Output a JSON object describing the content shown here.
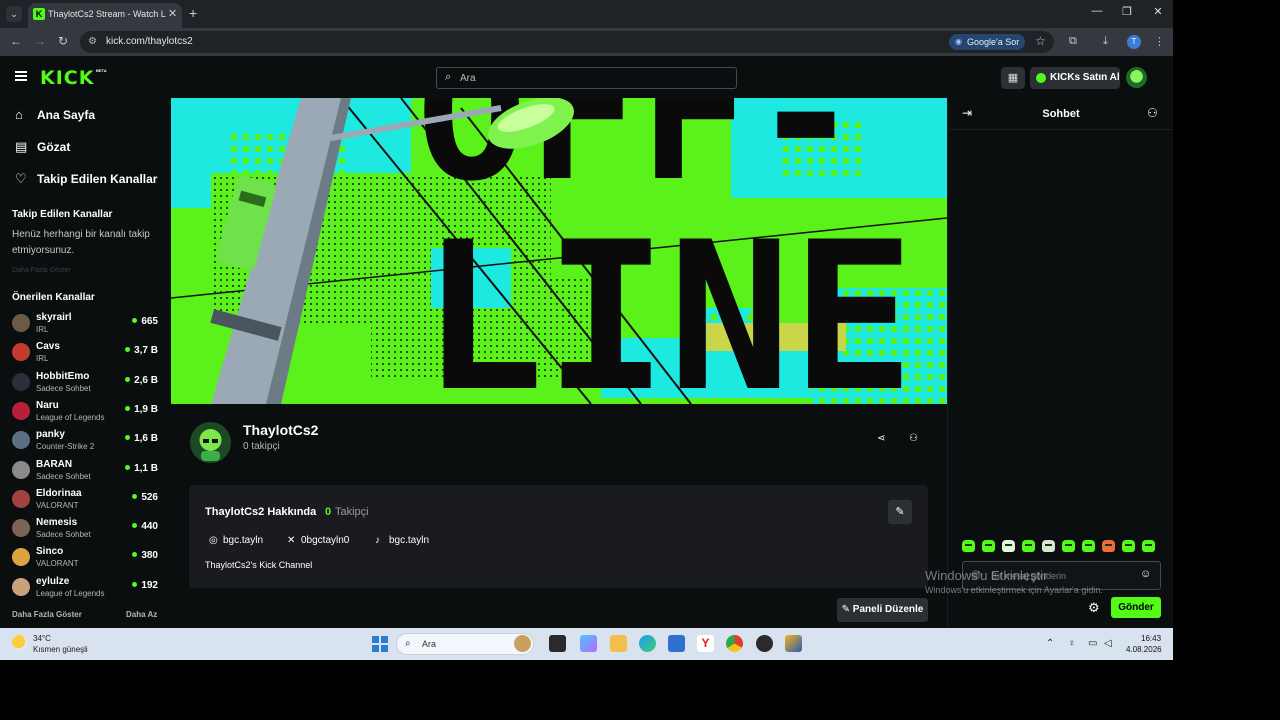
{
  "browser": {
    "tab_title": "ThaylotCs2 Stream - Watch Live",
    "tab_close": "✕",
    "new_tab": "+",
    "url": "kick.com/thaylotcs2",
    "google_button": "Google'a Sor",
    "window_minimize": "—",
    "window_restore": "❐",
    "window_close": "✕",
    "profile_initial": "T"
  },
  "header": {
    "logo": "KICK",
    "logo_badge": "BETA",
    "search_placeholder": "Ara",
    "kicks_button": "KICKs Satın Al"
  },
  "sidebar": {
    "nav": [
      {
        "label": "Ana Sayfa",
        "icon": "home-icon"
      },
      {
        "label": "Gözat",
        "icon": "browse-icon"
      },
      {
        "label": "Takip Edilen Kanallar",
        "icon": "heart-icon"
      }
    ],
    "followed_title": "Takip Edilen Kanallar",
    "followed_empty": "Henüz herhangi bir kanalı takip etmiyorsunuz.",
    "followed_more": "Daha Fazla Göster",
    "recommended_title": "Önerilen Kanallar",
    "channels": [
      {
        "name": "skyrairl",
        "category": "IRL",
        "viewers": "665",
        "color": "#6b5a4a"
      },
      {
        "name": "Cavs",
        "category": "IRL",
        "viewers": "3,7 B",
        "color": "#c43b2e"
      },
      {
        "name": "HobbitEmo",
        "category": "Sadece Sohbet",
        "viewers": "2,6 B",
        "color": "#2b2f3a"
      },
      {
        "name": "Naru",
        "category": "League of Legends",
        "viewers": "1,9 B",
        "color": "#b8203a"
      },
      {
        "name": "panky",
        "category": "Counter-Strike 2",
        "viewers": "1,6 B",
        "color": "#5b6f85"
      },
      {
        "name": "BARAN",
        "category": "Sadece Sohbet",
        "viewers": "1,1 B",
        "color": "#8a8a8a"
      },
      {
        "name": "Eldorinaa",
        "category": "VALORANT",
        "viewers": "526",
        "color": "#a3423e"
      },
      {
        "name": "Nemesis",
        "category": "Sadece Sohbet",
        "viewers": "440",
        "color": "#7a6458"
      },
      {
        "name": "Sinco",
        "category": "VALORANT",
        "viewers": "380",
        "color": "#d9a441"
      },
      {
        "name": "eylulze",
        "category": "League of Legends",
        "viewers": "192",
        "color": "#c9a27a"
      }
    ],
    "show_more": "Daha Fazla Göster",
    "show_less": "Daha Az"
  },
  "banner": {
    "line1": "OFF-",
    "line2": "LINE"
  },
  "channel": {
    "name": "ThaylotCs2",
    "followers": "0 takipçi",
    "about_title": "ThaylotCs2 Hakkında",
    "about_count": "0",
    "about_count_label": "Takipçi",
    "socials": [
      {
        "icon": "instagram-icon",
        "handle": "bgc.tayln"
      },
      {
        "icon": "x-icon",
        "handle": "0bgctayln0"
      },
      {
        "icon": "tiktok-icon",
        "handle": "bgc.tayln"
      }
    ],
    "description": "ThaylotCs2's Kick Channel",
    "edit_panel_button": "Paneli Düzenle"
  },
  "chat": {
    "title": "Sohbet",
    "input_placeholder": "Bir mesaj gönderin",
    "send_button": "Gönder"
  },
  "windows_watermark": {
    "line1": "Windows'u Etkinleştir",
    "line2": "Windows'u etkinleştirmek için Ayarlar'a gidin."
  },
  "taskbar": {
    "temperature": "34°C",
    "weather": "Kısmen güneşli",
    "search_placeholder": "Ara",
    "time": "16:43",
    "date": "4.08.2026"
  },
  "colors": {
    "brand_green": "#53fc18",
    "background": "#0b0e0f",
    "panel": "#191b1f"
  }
}
